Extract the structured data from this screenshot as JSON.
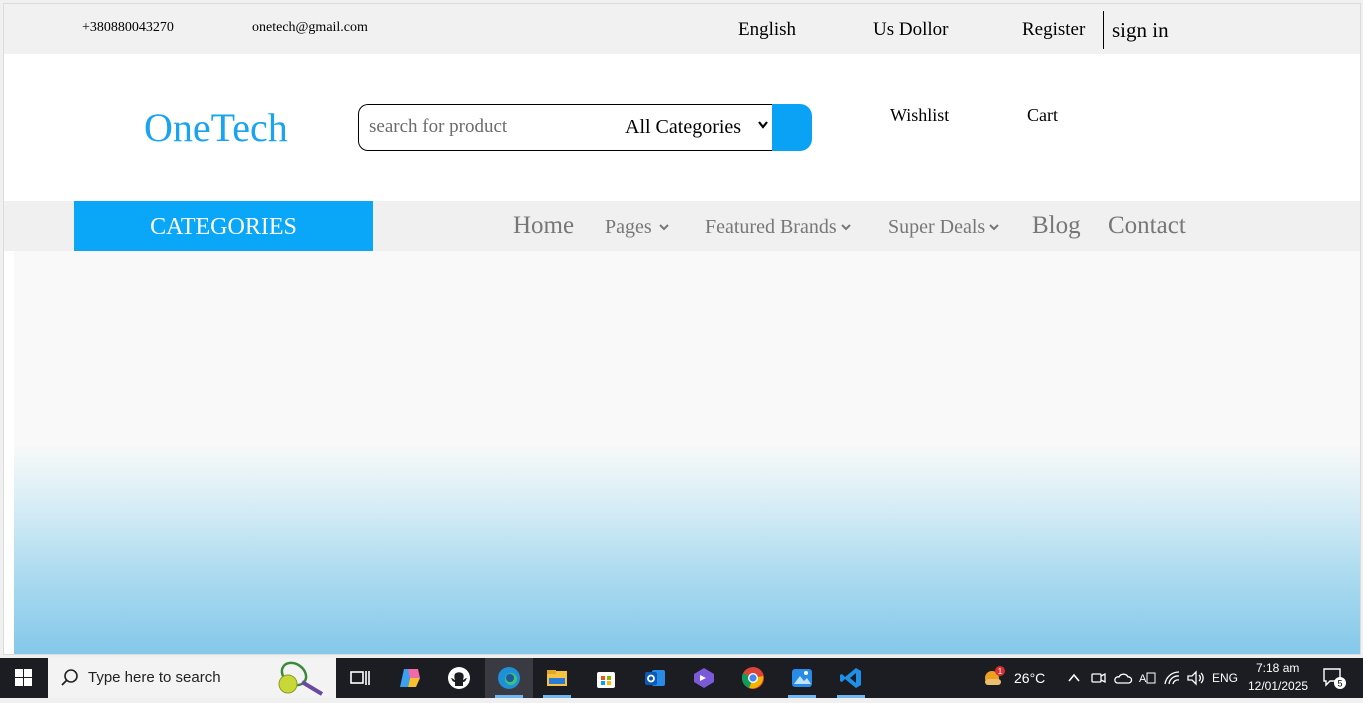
{
  "topbar": {
    "phone": "+380880043270",
    "email": "onetech@gmail.com",
    "language": "English",
    "currency": "Us Dollor",
    "register": "Register",
    "sign_in": "sign in"
  },
  "header": {
    "logo": "OneTech",
    "search_placeholder": "search for product",
    "category_select": "All Categories",
    "wishlist": "Wishlist",
    "cart": "Cart"
  },
  "nav": {
    "categories": "CATEGORIES",
    "home": "Home",
    "pages": "Pages",
    "featured_brands": "Featured Brands",
    "super_deals": "Super Deals",
    "blog": "Blog",
    "contact": "Contact"
  },
  "colors": {
    "brand_blue": "#0aa6f7",
    "logo_blue": "#1aa3f0",
    "nav_text": "#777777"
  },
  "taskbar": {
    "search_placeholder": "Type here to search",
    "weather_temp": "26°C",
    "weather_badge": "1",
    "language": "ENG",
    "time": "7:18 am",
    "date": "12/01/2025",
    "notification_count": "5",
    "apps": [
      "task-view-icon",
      "copilot-icon",
      "github-icon",
      "edge-icon",
      "file-explorer-icon",
      "microsoft-store-icon",
      "outlook-icon",
      "visual-studio-icon",
      "chrome-icon",
      "photos-icon",
      "vscode-icon"
    ]
  }
}
